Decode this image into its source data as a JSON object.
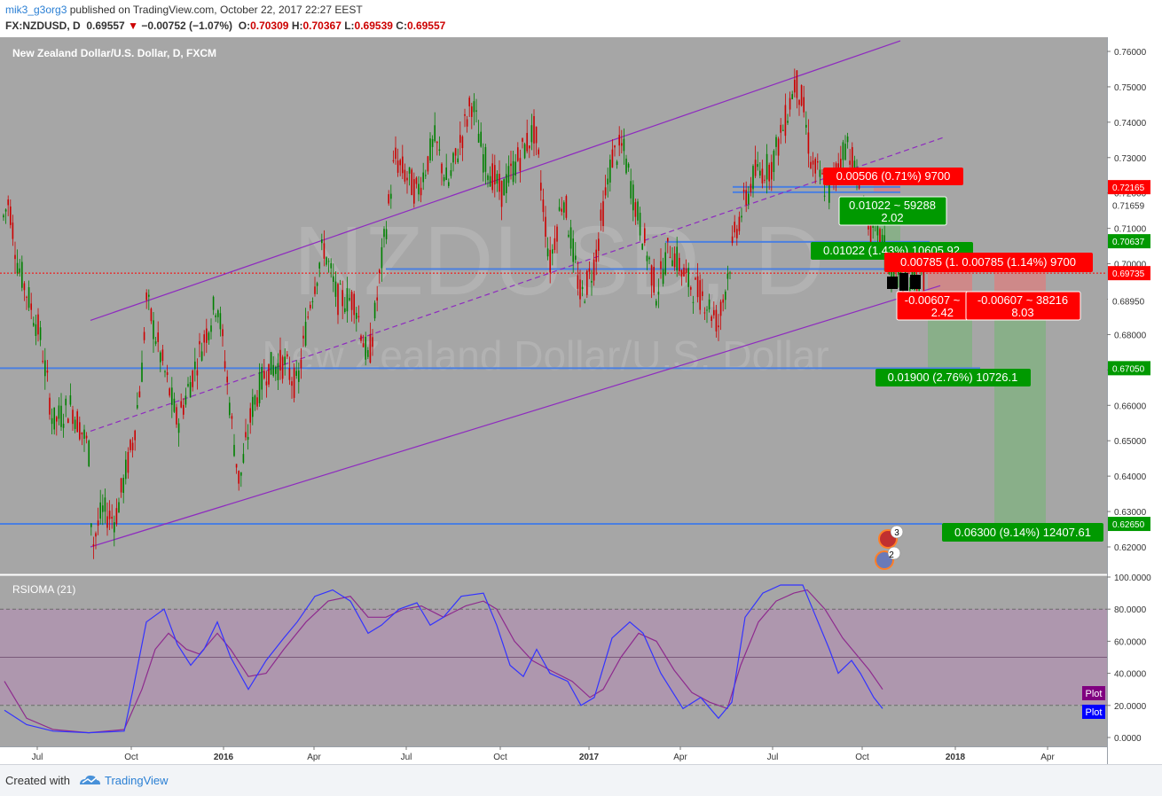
{
  "header": {
    "user": "mik3_g3org3",
    "published_text": "published on TradingView.com, October 22, 2017 22:27 EEST",
    "symbol": "FX:NZDUSD, D",
    "last": "0.69557",
    "change": "−0.00752 (−1.07%)",
    "o_label": "O:",
    "o": "0.70309",
    "h_label": "H:",
    "h": "0.70367",
    "l_label": "L:",
    "l": "0.69539",
    "c_label": "C:",
    "c": "0.69557"
  },
  "main_pane": {
    "title": "New Zealand Dollar/U.S. Dollar, D, FXCM",
    "watermark_symbol": "NZDUSD, D",
    "watermark_name": "New Zealand Dollar/U.S. Dollar"
  },
  "price_axis": {
    "ticks": [
      "0.76000",
      "0.75000",
      "0.74000",
      "0.73000",
      "0.72000",
      "0.71000",
      "0.70000",
      "0.69000",
      "0.68000",
      "0.67000",
      "0.66000",
      "0.65000",
      "0.64000",
      "0.63000",
      "0.62000"
    ],
    "markers": [
      {
        "label": "0.72165",
        "value": 0.72165,
        "color": "#ff0000"
      },
      {
        "label": "0.71659",
        "value": 0.71659,
        "color": "#ffffff"
      },
      {
        "label": "0.70637",
        "value": 0.70637,
        "color": "#009900"
      },
      {
        "label": "0.69735",
        "value": 0.69735,
        "color": "#ff0000"
      },
      {
        "label": "0.68950",
        "value": 0.6895,
        "color": "#ffffff"
      },
      {
        "label": "0.67050",
        "value": 0.6705,
        "color": "#009900"
      },
      {
        "label": "0.62650",
        "value": 0.6265,
        "color": "#009900"
      }
    ]
  },
  "time_axis": {
    "labels": [
      {
        "text": "Jul",
        "bold": false
      },
      {
        "text": "Oct",
        "bold": false
      },
      {
        "text": "2016",
        "bold": true
      },
      {
        "text": "Apr",
        "bold": false
      },
      {
        "text": "Jul",
        "bold": false
      },
      {
        "text": "Oct",
        "bold": false
      },
      {
        "text": "2017",
        "bold": true
      },
      {
        "text": "Apr",
        "bold": false
      },
      {
        "text": "Jul",
        "bold": false
      },
      {
        "text": "Oct",
        "bold": false
      },
      {
        "text": "2018",
        "bold": true
      },
      {
        "text": "Apr",
        "bold": false
      }
    ]
  },
  "annotations": [
    {
      "text": "0.00506 (0.71%) 9700",
      "color": "#ff0000"
    },
    {
      "text": "0.01022 ~ 59288",
      "text2": "2.02",
      "color": "#009900"
    },
    {
      "text": "0.01022 (1.43%) 10605.92",
      "color": "#009900"
    },
    {
      "text": "0.00785 (1. 0.00785 (1.14%) 9700",
      "color": "#ff0000"
    },
    {
      "text": "-0.00607 ~",
      "text2": "2.42",
      "color": "#ff0000"
    },
    {
      "text": "-0.00607 ~ 38216",
      "text2": "8.03",
      "color": "#ff0000"
    },
    {
      "text": "0.01900 (2.76%) 10726.1",
      "color": "#009900"
    },
    {
      "text": "0.06300 (9.14%) 12407.61",
      "color": "#009900"
    }
  ],
  "events": [
    {
      "badge": "3",
      "flag": "nz-flag-icon"
    },
    {
      "badge": "2",
      "flag": "us-flag-icon"
    }
  ],
  "indicator": {
    "title": "RSIOMA (21)",
    "ticks": [
      "100.0000",
      "80.0000",
      "60.0000",
      "40.0000",
      "20.0000",
      "0.0000"
    ],
    "plot_labels": [
      {
        "text": "Plot",
        "color": "#800080"
      },
      {
        "text": "Plot",
        "color": "#0000ff"
      }
    ]
  },
  "footer": {
    "created_with": "Created with",
    "brand": "TradingView"
  },
  "colors": {
    "background": "#a6a6a6",
    "up_candle": "#008000",
    "down_candle": "#cc0000",
    "channel": "#8e2bbf",
    "level_line": "#4a7fe0",
    "rsi_line": "#3333ff",
    "rsi_signal": "#8e2b8e",
    "rsi_band": "#b48ab4"
  },
  "chart_data": {
    "type": "candlestick",
    "symbol": "NZDUSD",
    "interval": "D",
    "ylim": [
      0.615,
      0.7625
    ],
    "horizontal_levels": [
      0.7217,
      0.7202,
      0.7062,
      0.6985,
      0.6705,
      0.6265
    ],
    "price_path": [
      [
        0,
        0.71
      ],
      [
        10,
        0.718
      ],
      [
        20,
        0.7
      ],
      [
        45,
        0.68
      ],
      [
        60,
        0.655
      ],
      [
        80,
        0.66
      ],
      [
        100,
        0.648
      ],
      [
        104,
        0.62
      ],
      [
        115,
        0.63
      ],
      [
        130,
        0.628
      ],
      [
        150,
        0.65
      ],
      [
        160,
        0.67
      ],
      [
        165,
        0.69
      ],
      [
        180,
        0.675
      ],
      [
        200,
        0.655
      ],
      [
        225,
        0.675
      ],
      [
        245,
        0.69
      ],
      [
        255,
        0.67
      ],
      [
        262,
        0.653
      ],
      [
        270,
        0.638
      ],
      [
        285,
        0.66
      ],
      [
        300,
        0.67
      ],
      [
        320,
        0.672
      ],
      [
        335,
        0.665
      ],
      [
        350,
        0.69
      ],
      [
        365,
        0.705
      ],
      [
        380,
        0.69
      ],
      [
        400,
        0.69
      ],
      [
        415,
        0.672
      ],
      [
        420,
        0.68
      ],
      [
        430,
        0.7
      ],
      [
        445,
        0.73
      ],
      [
        470,
        0.72
      ],
      [
        490,
        0.735
      ],
      [
        505,
        0.722
      ],
      [
        532,
        0.746
      ],
      [
        545,
        0.73
      ],
      [
        565,
        0.72
      ],
      [
        585,
        0.73
      ],
      [
        603,
        0.738
      ],
      [
        620,
        0.7
      ],
      [
        635,
        0.72
      ],
      [
        655,
        0.69
      ],
      [
        670,
        0.7
      ],
      [
        690,
        0.73
      ],
      [
        702,
        0.733
      ],
      [
        715,
        0.718
      ],
      [
        740,
        0.692
      ],
      [
        755,
        0.705
      ],
      [
        775,
        0.695
      ],
      [
        795,
        0.69
      ],
      [
        810,
        0.683
      ],
      [
        830,
        0.71
      ],
      [
        850,
        0.725
      ],
      [
        870,
        0.728
      ],
      [
        885,
        0.74
      ],
      [
        897,
        0.752
      ],
      [
        905,
        0.745
      ],
      [
        915,
        0.728
      ],
      [
        935,
        0.72
      ],
      [
        948,
        0.73
      ],
      [
        955,
        0.735
      ],
      [
        965,
        0.725
      ],
      [
        975,
        0.715
      ],
      [
        985,
        0.708
      ],
      [
        995,
        0.706
      ],
      [
        1005,
        0.698
      ],
      [
        1025,
        0.695
      ],
      [
        1045,
        0.696
      ]
    ],
    "channel": {
      "upper": [
        [
          102,
          0.684
        ],
        [
          1015,
          0.763
        ]
      ],
      "middle": [
        [
          102,
          0.6527
        ],
        [
          1065,
          0.7358
        ]
      ],
      "lower": [
        [
          102,
          0.62
        ],
        [
          1060,
          0.6938
        ]
      ]
    },
    "indicator": {
      "name": "RSIOMA (21)",
      "ylim": [
        0,
        100
      ],
      "levels": [
        80,
        50,
        20
      ],
      "rsi": [
        [
          5,
          17
        ],
        [
          30,
          8
        ],
        [
          60,
          4
        ],
        [
          100,
          3
        ],
        [
          140,
          4
        ],
        [
          150,
          30
        ],
        [
          165,
          72
        ],
        [
          185,
          80
        ],
        [
          200,
          58
        ],
        [
          215,
          45
        ],
        [
          230,
          55
        ],
        [
          245,
          72
        ],
        [
          260,
          50
        ],
        [
          280,
          30
        ],
        [
          300,
          48
        ],
        [
          320,
          62
        ],
        [
          335,
          72
        ],
        [
          355,
          88
        ],
        [
          375,
          92
        ],
        [
          395,
          85
        ],
        [
          415,
          65
        ],
        [
          430,
          70
        ],
        [
          450,
          80
        ],
        [
          470,
          84
        ],
        [
          485,
          70
        ],
        [
          500,
          75
        ],
        [
          520,
          88
        ],
        [
          545,
          90
        ],
        [
          560,
          70
        ],
        [
          575,
          45
        ],
        [
          590,
          38
        ],
        [
          605,
          55
        ],
        [
          620,
          40
        ],
        [
          640,
          35
        ],
        [
          655,
          20
        ],
        [
          670,
          25
        ],
        [
          690,
          62
        ],
        [
          710,
          72
        ],
        [
          725,
          65
        ],
        [
          745,
          40
        ],
        [
          770,
          18
        ],
        [
          790,
          25
        ],
        [
          810,
          12
        ],
        [
          825,
          22
        ],
        [
          840,
          75
        ],
        [
          860,
          90
        ],
        [
          880,
          95
        ],
        [
          905,
          95
        ],
        [
          920,
          75
        ],
        [
          935,
          55
        ],
        [
          945,
          40
        ],
        [
          960,
          48
        ],
        [
          970,
          40
        ],
        [
          985,
          25
        ],
        [
          995,
          18
        ]
      ],
      "signal": [
        [
          5,
          35
        ],
        [
          30,
          12
        ],
        [
          60,
          5
        ],
        [
          100,
          3
        ],
        [
          140,
          5
        ],
        [
          160,
          30
        ],
        [
          175,
          55
        ],
        [
          190,
          65
        ],
        [
          210,
          55
        ],
        [
          225,
          52
        ],
        [
          245,
          65
        ],
        [
          260,
          55
        ],
        [
          280,
          38
        ],
        [
          300,
          40
        ],
        [
          320,
          55
        ],
        [
          345,
          72
        ],
        [
          370,
          85
        ],
        [
          395,
          88
        ],
        [
          415,
          75
        ],
        [
          435,
          75
        ],
        [
          455,
          80
        ],
        [
          475,
          82
        ],
        [
          500,
          75
        ],
        [
          525,
          82
        ],
        [
          545,
          85
        ],
        [
          560,
          80
        ],
        [
          580,
          60
        ],
        [
          600,
          48
        ],
        [
          620,
          42
        ],
        [
          645,
          35
        ],
        [
          665,
          25
        ],
        [
          680,
          30
        ],
        [
          700,
          50
        ],
        [
          720,
          65
        ],
        [
          740,
          60
        ],
        [
          760,
          42
        ],
        [
          780,
          28
        ],
        [
          800,
          22
        ],
        [
          820,
          18
        ],
        [
          835,
          45
        ],
        [
          855,
          72
        ],
        [
          875,
          85
        ],
        [
          895,
          90
        ],
        [
          910,
          92
        ],
        [
          930,
          80
        ],
        [
          950,
          62
        ],
        [
          965,
          52
        ],
        [
          980,
          42
        ],
        [
          995,
          30
        ]
      ]
    }
  }
}
